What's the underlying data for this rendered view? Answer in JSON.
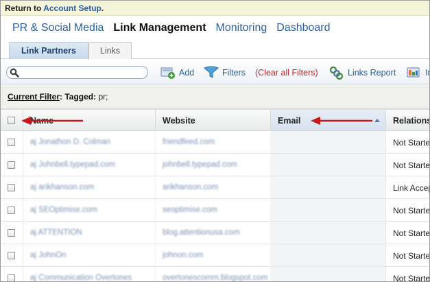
{
  "return_bar": {
    "prefix": "Return to",
    "link": "Account Setup",
    "suffix": "."
  },
  "main_nav": [
    {
      "label": "PR & Social Media",
      "active": false
    },
    {
      "label": "Link Management",
      "active": true
    },
    {
      "label": "Monitoring",
      "active": false
    },
    {
      "label": "Dashboard",
      "active": false
    }
  ],
  "sub_tabs": [
    {
      "label": "Link Partners",
      "active": true
    },
    {
      "label": "Links",
      "active": false
    }
  ],
  "toolbar": {
    "search_value": "",
    "add_label": "Add",
    "filters_label": "Filters",
    "clear_filters_label": "(Clear all Filters)",
    "links_report_label": "Links Report",
    "truncated_label": "In"
  },
  "current_filter": {
    "label": "Current Filter",
    "colon": ":",
    "tag_label": "Tagged:",
    "tag_value": "pr;"
  },
  "table": {
    "columns": [
      "Name",
      "Website",
      "Email",
      "Relations"
    ],
    "sorted_column": "Email",
    "rows": [
      {
        "name": "aj Jonathon D. Colman",
        "website": "friendfeed.com",
        "email": "",
        "relation": "Not Started"
      },
      {
        "name": "aj Johnbell.typepad.com",
        "website": "johnbell.typepad.com",
        "email": "",
        "relation": "Not Started"
      },
      {
        "name": "aj arikhanson.com",
        "website": "arikhanson.com",
        "email": "",
        "relation": "Link Accepted"
      },
      {
        "name": "aj SEOptimise.com",
        "website": "seoptimise.com",
        "email": "",
        "relation": "Not Started"
      },
      {
        "name": "aj ATTENTION",
        "website": "blog.attentionusa.com",
        "email": "",
        "relation": "Not Started"
      },
      {
        "name": "aj JohnOn",
        "website": "johnon.com",
        "email": "",
        "relation": "Not Started"
      },
      {
        "name": "aj Communication Overtones",
        "website": "overtonescomm.blogspot.com",
        "email": "",
        "relation": "Not Started"
      }
    ]
  },
  "colors": {
    "link": "#2a5fa0",
    "clear_filters": "#c0262c",
    "annotation_arrow": "#c8161d",
    "tab_active_bg": "#c7daee"
  },
  "icons": {
    "search": "search-icon",
    "add": "add-partner-icon",
    "filters": "funnel-icon",
    "links_report": "links-report-icon",
    "truncated": "report-icon"
  }
}
